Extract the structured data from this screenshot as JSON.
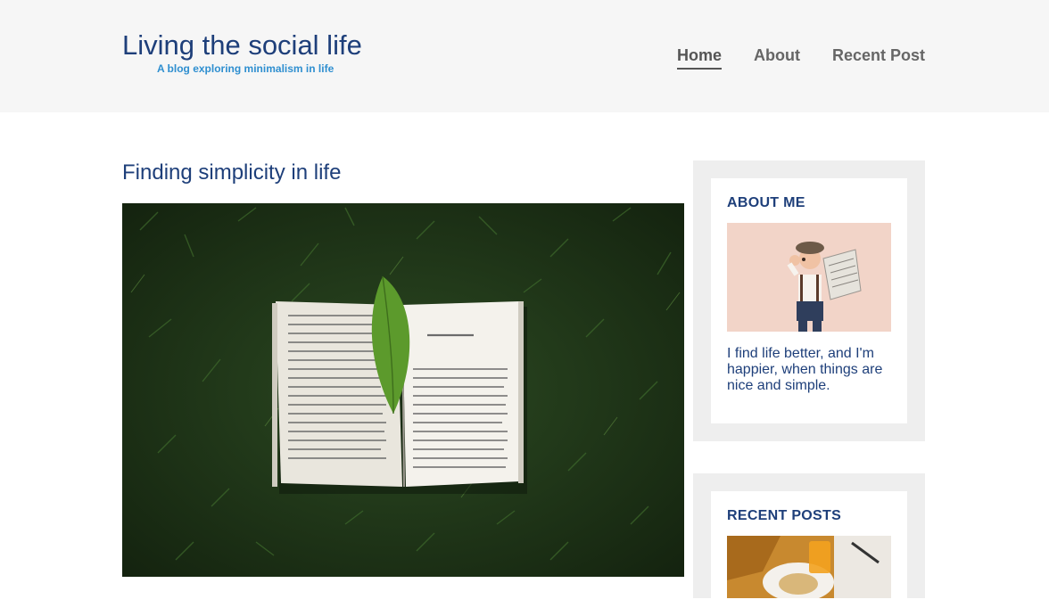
{
  "site": {
    "title": "Living the social life",
    "tagline": "A blog exploring minimalism in life"
  },
  "nav": {
    "items": [
      {
        "label": "Home",
        "active": true
      },
      {
        "label": "About",
        "active": false
      },
      {
        "label": "Recent Post",
        "active": false
      }
    ]
  },
  "post": {
    "title": "Finding simplicity in life",
    "image_alt": "open-book-on-grass-photo"
  },
  "sidebar": {
    "about": {
      "title": "ABOUT ME",
      "text": "I find life better, and I'm happier, when things are nice and simple."
    },
    "recent": {
      "title": "RECENT POSTS"
    }
  },
  "colors": {
    "accent": "#1e3f7a",
    "tagline": "#2f8fd0",
    "header_bg": "#f6f6f6",
    "widget_bg": "#eeeeee"
  }
}
